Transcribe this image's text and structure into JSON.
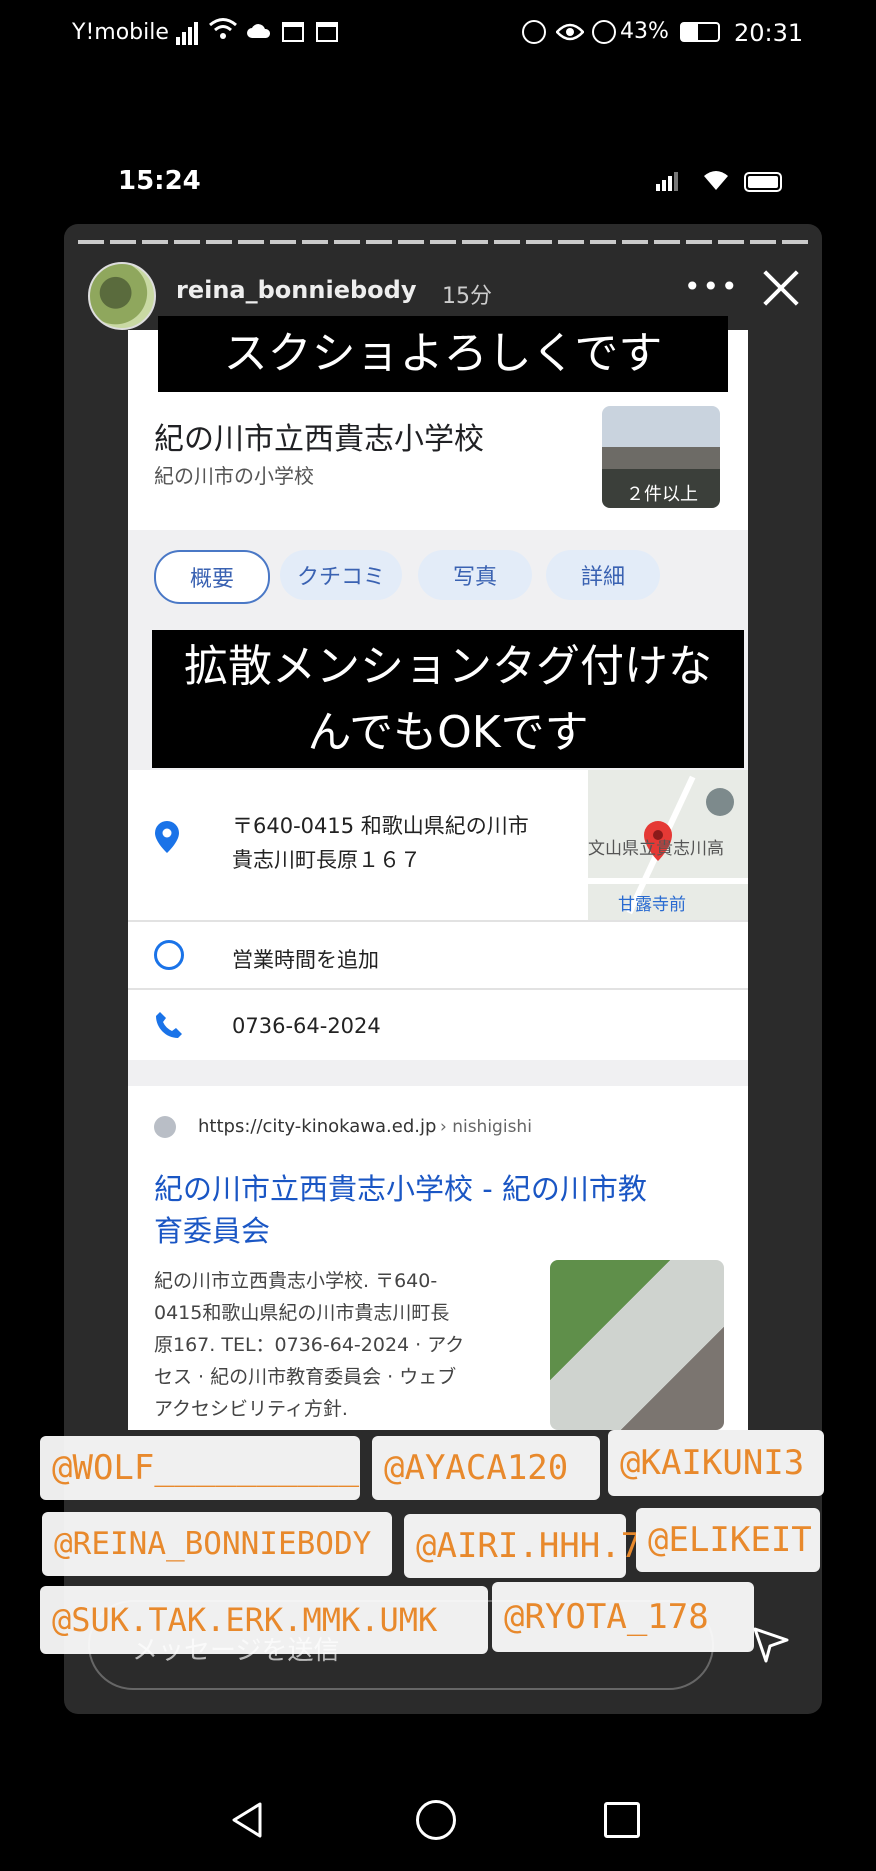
{
  "device_status": {
    "carrier": "Y!mobile",
    "battery": "43%",
    "time": "20:31"
  },
  "inner_status": {
    "time": "15:24"
  },
  "story": {
    "username": "reina_bonniebody",
    "age": "15分"
  },
  "banner_top": "スクショよろしくです",
  "place": {
    "name": "紀の川市立西貴志小学校",
    "category": "紀の川市の小学校",
    "photo_count": "２件以上"
  },
  "tabs": [
    "概要",
    "クチコミ",
    "写真",
    "詳細"
  ],
  "banner_mid": [
    "拡散メンションタグ付けな",
    "んでもOKです"
  ],
  "details": {
    "address_line1": "〒640-0415 和歌山県紀の川市",
    "address_line2": "貴志川町長原１６７",
    "map_label1": "文山県立貴志川高",
    "map_label2": "甘露寺前",
    "hours": "営業時間を追加",
    "phone": "0736-64-2024"
  },
  "result": {
    "url": "https://city-kinokawa.ed.jp",
    "url_path": "› nishigishi",
    "title_line1": "紀の川市立西貴志小学校 - 紀の川市教",
    "title_line2": "育委員会",
    "snippet": [
      "紀の川市立西貴志小学校. 〒640-",
      "0415和歌山県紀の川市貴志川町長",
      "原167. TEL：0736-64-2024 · アク",
      "セス · 紀の川市教育委員会 · ウェブ",
      "アクセシビリティ方針."
    ]
  },
  "mentions": [
    "@WOLF__________",
    "@AYACA120",
    "@KAIKUNI3",
    "@REINA_BONNIEBODY",
    "@AIRI.HHH.7",
    "@ELIKEIT",
    "@SUK.TAK.ERK.MMK.UMK",
    "@RYOTA_178"
  ],
  "message_placeholder": "メッセージを送信",
  "colors": {
    "accent": "#3a62b2",
    "tag_text": "#e8892c",
    "pin": "#e53935"
  }
}
